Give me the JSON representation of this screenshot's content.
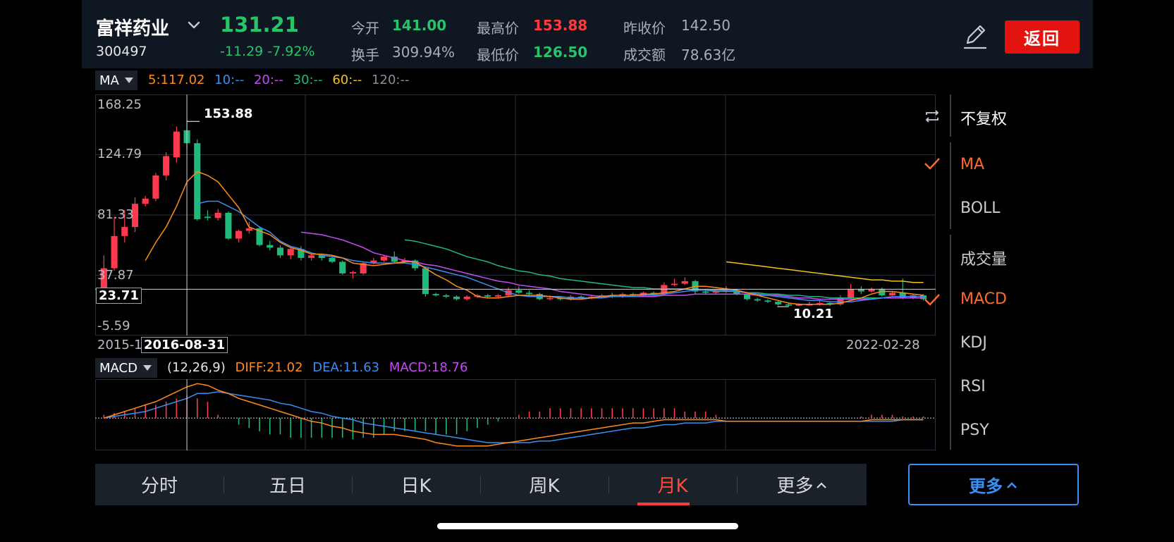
{
  "stock": {
    "name": "富祥药业",
    "code": "300497",
    "price": "131.21",
    "change": "-11.29 -7.92%"
  },
  "quote": {
    "open_label": "今开",
    "open": "141.00",
    "high_label": "最高价",
    "high": "153.88",
    "prev_close_label": "昨收价",
    "prev_close": "142.50",
    "turnover_rate_label": "换手",
    "turnover_rate": "309.94%",
    "low_label": "最低价",
    "low": "126.50",
    "amount_label": "成交额",
    "amount": "78.63亿"
  },
  "header": {
    "back_label": "返回"
  },
  "colors": {
    "up": "#ff3a4f",
    "down": "#1fb97a",
    "ma5": "#ff8a1c",
    "ma10": "#3a8ff2",
    "ma20": "#c44cf2",
    "ma30": "#1fb97a",
    "ma60": "#f2c21f",
    "ma120": "#8a8d93",
    "accent": "#ff6a2c"
  },
  "main_indicator": {
    "name": "MA",
    "items": [
      "5:117.02",
      "10:--",
      "20:--",
      "30:--",
      "60:--",
      "120:--"
    ]
  },
  "main_chart": {
    "y_labels": [
      "168.25",
      "124.79",
      "81.33",
      "37.87",
      "-5.59"
    ],
    "start_date": "2015-1",
    "cursor_date": "2016-08-31",
    "end_date": "2022-02-28",
    "crosshair_price": "23.71",
    "max_label": "153.88",
    "min_label": "10.21"
  },
  "sub_indicator": {
    "name": "MACD",
    "params": "(12,26,9)",
    "diff": "DIFF:21.02",
    "dea": "DEA:11.63",
    "macd": "MACD:18.76"
  },
  "side_panel": {
    "adjust": "不复权",
    "overlays": [
      "MA",
      "BOLL"
    ],
    "overlay_selected": "MA",
    "indicators": [
      "成交量",
      "MACD",
      "KDJ",
      "RSI",
      "PSY"
    ],
    "indicator_selected": "MACD"
  },
  "tabs": [
    "分时",
    "五日",
    "日K",
    "周K",
    "月K",
    "更多"
  ],
  "active_tab": "月K",
  "more_button": "更多",
  "chart_data": {
    "type": "candlestick",
    "y_range": [
      -5.59,
      168.25
    ],
    "candles": [
      {
        "o": 20,
        "c": 40,
        "h": 50,
        "l": 18
      },
      {
        "o": 40,
        "c": 65,
        "h": 80,
        "l": 38
      },
      {
        "o": 65,
        "c": 72,
        "h": 85,
        "l": 60
      },
      {
        "o": 72,
        "c": 90,
        "h": 95,
        "l": 68
      },
      {
        "o": 90,
        "c": 94,
        "h": 96,
        "l": 88
      },
      {
        "o": 94,
        "c": 112,
        "h": 114,
        "l": 92
      },
      {
        "o": 112,
        "c": 127,
        "h": 130,
        "l": 108
      },
      {
        "o": 126,
        "c": 146,
        "h": 150,
        "l": 122
      },
      {
        "o": 147,
        "c": 137,
        "h": 155,
        "l": 132
      },
      {
        "o": 137,
        "c": 78,
        "h": 140,
        "l": 77
      },
      {
        "o": 80,
        "c": 79,
        "h": 85,
        "l": 77
      },
      {
        "o": 79,
        "c": 83,
        "h": 86,
        "l": 77
      },
      {
        "o": 83,
        "c": 63,
        "h": 84,
        "l": 62
      },
      {
        "o": 63,
        "c": 69,
        "h": 70,
        "l": 60
      },
      {
        "o": 69,
        "c": 71,
        "h": 76,
        "l": 67
      },
      {
        "o": 71,
        "c": 58,
        "h": 72,
        "l": 57
      },
      {
        "o": 58,
        "c": 56,
        "h": 61,
        "l": 54
      },
      {
        "o": 56,
        "c": 50,
        "h": 58,
        "l": 48
      },
      {
        "o": 50,
        "c": 55,
        "h": 56,
        "l": 47
      },
      {
        "o": 55,
        "c": 48,
        "h": 57,
        "l": 46
      },
      {
        "o": 48,
        "c": 50,
        "h": 51,
        "l": 46
      },
      {
        "o": 50,
        "c": 48,
        "h": 51,
        "l": 46
      },
      {
        "o": 48,
        "c": 45,
        "h": 50,
        "l": 44
      },
      {
        "o": 45,
        "c": 36,
        "h": 46,
        "l": 35
      },
      {
        "o": 36,
        "c": 37,
        "h": 38,
        "l": 32
      },
      {
        "o": 36,
        "c": 44,
        "h": 45,
        "l": 35
      },
      {
        "o": 44,
        "c": 46,
        "h": 48,
        "l": 43
      },
      {
        "o": 46,
        "c": 49,
        "h": 50,
        "l": 45
      },
      {
        "o": 49,
        "c": 45,
        "h": 53,
        "l": 44
      },
      {
        "o": 45,
        "c": 46,
        "h": 48,
        "l": 44
      },
      {
        "o": 46,
        "c": 40,
        "h": 47,
        "l": 38
      },
      {
        "o": 40,
        "c": 20,
        "h": 41,
        "l": 18
      },
      {
        "o": 20,
        "c": 19,
        "h": 21,
        "l": 18
      },
      {
        "o": 19,
        "c": 18,
        "h": 20,
        "l": 17
      },
      {
        "o": 18,
        "c": 16,
        "h": 19,
        "l": 15
      },
      {
        "o": 16,
        "c": 18,
        "h": 19,
        "l": 15
      },
      {
        "o": 18,
        "c": 19,
        "h": 20,
        "l": 17
      },
      {
        "o": 19,
        "c": 18,
        "h": 20,
        "l": 17
      },
      {
        "o": 18,
        "c": 19,
        "h": 20,
        "l": 17
      },
      {
        "o": 19,
        "c": 23,
        "h": 25,
        "l": 18
      },
      {
        "o": 23,
        "c": 21,
        "h": 26,
        "l": 20
      },
      {
        "o": 21,
        "c": 20,
        "h": 23,
        "l": 19
      },
      {
        "o": 20,
        "c": 16,
        "h": 21,
        "l": 15
      },
      {
        "o": 16,
        "c": 17,
        "h": 19,
        "l": 15
      },
      {
        "o": 17,
        "c": 16,
        "h": 18,
        "l": 15
      },
      {
        "o": 16,
        "c": 18,
        "h": 19,
        "l": 15
      },
      {
        "o": 18,
        "c": 17,
        "h": 19,
        "l": 16
      },
      {
        "o": 17,
        "c": 18,
        "h": 19,
        "l": 16
      },
      {
        "o": 18,
        "c": 19,
        "h": 20,
        "l": 17
      },
      {
        "o": 19,
        "c": 18,
        "h": 21,
        "l": 17
      },
      {
        "o": 18,
        "c": 20,
        "h": 21,
        "l": 17
      },
      {
        "o": 20,
        "c": 19,
        "h": 21,
        "l": 18
      },
      {
        "o": 19,
        "c": 21,
        "h": 22,
        "l": 18
      },
      {
        "o": 21,
        "c": 20,
        "h": 22,
        "l": 19
      },
      {
        "o": 20,
        "c": 27,
        "h": 29,
        "l": 19
      },
      {
        "o": 27,
        "c": 28,
        "h": 32,
        "l": 26
      },
      {
        "o": 28,
        "c": 30,
        "h": 33,
        "l": 27
      },
      {
        "o": 30,
        "c": 22,
        "h": 31,
        "l": 20
      },
      {
        "o": 22,
        "c": 21,
        "h": 24,
        "l": 20
      },
      {
        "o": 21,
        "c": 22,
        "h": 23,
        "l": 20
      },
      {
        "o": 22,
        "c": 23,
        "h": 26,
        "l": 21
      },
      {
        "o": 23,
        "c": 20,
        "h": 24,
        "l": 19
      },
      {
        "o": 20,
        "c": 16,
        "h": 21,
        "l": 15
      },
      {
        "o": 16,
        "c": 15,
        "h": 17,
        "l": 14
      },
      {
        "o": 15,
        "c": 14,
        "h": 16,
        "l": 13
      },
      {
        "o": 14,
        "c": 12,
        "h": 15,
        "l": 11
      },
      {
        "o": 12,
        "c": 11,
        "h": 13,
        "l": 10.21
      },
      {
        "o": 11,
        "c": 12,
        "h": 13,
        "l": 10.5
      },
      {
        "o": 12,
        "c": 12,
        "h": 14,
        "l": 11
      },
      {
        "o": 12,
        "c": 13,
        "h": 15,
        "l": 11
      },
      {
        "o": 13,
        "c": 12,
        "h": 14,
        "l": 11
      },
      {
        "o": 12,
        "c": 17,
        "h": 19,
        "l": 11
      },
      {
        "o": 17,
        "c": 24,
        "h": 28,
        "l": 16
      },
      {
        "o": 24,
        "c": 22,
        "h": 26,
        "l": 20
      },
      {
        "o": 22,
        "c": 24,
        "h": 25,
        "l": 21
      },
      {
        "o": 24,
        "c": 19,
        "h": 25,
        "l": 18
      },
      {
        "o": 19,
        "c": 21,
        "h": 22,
        "l": 18
      },
      {
        "o": 21,
        "c": 17,
        "h": 32,
        "l": 16
      },
      {
        "o": 17,
        "c": 19,
        "h": 20,
        "l": 16
      },
      {
        "o": 19,
        "c": 16,
        "h": 20,
        "l": 15
      }
    ],
    "ma5": [
      null,
      null,
      null,
      null,
      46,
      60,
      72,
      88,
      107,
      115,
      112,
      107,
      97,
      87,
      72,
      69,
      66,
      60,
      56,
      54,
      51,
      51,
      50,
      48,
      44,
      43,
      42,
      43,
      44,
      45,
      45,
      40,
      35,
      31,
      26,
      23,
      18,
      17,
      17,
      18,
      19,
      19,
      19,
      18,
      17,
      16,
      16,
      17,
      18,
      19,
      19,
      19,
      20,
      20,
      21,
      22,
      24,
      26,
      26,
      25,
      24,
      23,
      21,
      19,
      17,
      15,
      13,
      12,
      12,
      12,
      12,
      13,
      15,
      17,
      20,
      22,
      22,
      21,
      20,
      19
    ],
    "ma10": [
      null,
      null,
      null,
      null,
      null,
      null,
      null,
      null,
      null,
      90,
      92,
      92,
      88,
      84,
      78,
      72,
      68,
      61,
      57,
      55,
      52,
      50,
      49,
      48,
      46,
      45,
      44,
      44,
      44,
      44,
      43,
      41,
      39,
      37,
      35,
      33,
      30,
      27,
      24,
      21,
      19,
      18,
      18,
      18,
      18,
      17,
      17,
      17,
      17,
      18,
      18,
      18,
      19,
      19,
      20,
      21,
      22,
      23,
      23,
      23,
      23,
      22,
      21,
      20,
      19,
      18,
      17,
      16,
      15,
      15,
      14,
      14,
      14,
      15,
      16,
      17,
      18,
      18,
      18,
      18
    ],
    "ma20": [
      null,
      null,
      null,
      null,
      null,
      null,
      null,
      null,
      null,
      null,
      null,
      null,
      null,
      null,
      null,
      null,
      null,
      null,
      null,
      68,
      67,
      66,
      64,
      62,
      59,
      56,
      52,
      50,
      48,
      46,
      45,
      43,
      42,
      40,
      38,
      36,
      34,
      32,
      30,
      29,
      27,
      26,
      25,
      24,
      22,
      21,
      20,
      19,
      18,
      18,
      18,
      18,
      18,
      18,
      19,
      19,
      19,
      20,
      20,
      20,
      20,
      20,
      20,
      19,
      19,
      19,
      18,
      17,
      17,
      16,
      16,
      16,
      16,
      16,
      16,
      17,
      17,
      17,
      17,
      17
    ],
    "ma30": [
      null,
      null,
      null,
      null,
      null,
      null,
      null,
      null,
      null,
      null,
      null,
      null,
      null,
      null,
      null,
      null,
      null,
      null,
      null,
      null,
      null,
      null,
      null,
      null,
      null,
      null,
      null,
      null,
      null,
      62,
      61,
      59,
      57,
      55,
      52,
      49,
      47,
      45,
      42,
      40,
      38,
      37,
      35,
      34,
      32,
      31,
      30,
      29,
      28,
      27,
      26,
      25,
      25,
      24,
      24,
      24,
      24,
      23,
      23,
      22,
      22,
      22,
      21,
      21,
      20,
      20,
      19,
      19,
      18,
      18,
      17,
      17,
      17,
      17,
      17,
      17,
      17,
      17,
      17,
      17
    ],
    "ma60": [
      null,
      null,
      null,
      null,
      null,
      null,
      null,
      null,
      null,
      null,
      null,
      null,
      null,
      null,
      null,
      null,
      null,
      null,
      null,
      null,
      null,
      null,
      null,
      null,
      null,
      null,
      null,
      null,
      null,
      null,
      null,
      null,
      null,
      null,
      null,
      null,
      null,
      null,
      null,
      null,
      null,
      null,
      null,
      null,
      null,
      null,
      null,
      null,
      null,
      null,
      null,
      null,
      null,
      null,
      null,
      null,
      null,
      null,
      null,
      null,
      45,
      44,
      43,
      42,
      41,
      40,
      39,
      38,
      37,
      36,
      35,
      34,
      33,
      32,
      31,
      31,
      30,
      30,
      29,
      29
    ],
    "diff": [
      0,
      2,
      4,
      6,
      8,
      10,
      13,
      16,
      19,
      21,
      20,
      17,
      15,
      12,
      10,
      8,
      6,
      4,
      2,
      0,
      -2,
      -3,
      -5,
      -6,
      -8,
      -9,
      -10,
      -10,
      -10,
      -11,
      -12,
      -13,
      -15,
      -16,
      -17,
      -17,
      -17,
      -17,
      -16,
      -15,
      -14,
      -13,
      -12,
      -11,
      -10,
      -9,
      -8,
      -7,
      -6,
      -5,
      -4,
      -3,
      -3,
      -2,
      -1,
      -1,
      -1,
      -1,
      -1,
      -1,
      -2,
      -2,
      -2,
      -2,
      -2,
      -2,
      -2,
      -2,
      -2,
      -2,
      -2,
      -2,
      -2,
      -2,
      -1,
      -1,
      -1,
      -1,
      -1,
      -1
    ],
    "dea": [
      0,
      1,
      2,
      3,
      4,
      6,
      8,
      10,
      12,
      15,
      15,
      16,
      15,
      14,
      13,
      12,
      11,
      9,
      8,
      6,
      4,
      3,
      1,
      0,
      -1,
      -3,
      -4,
      -5,
      -6,
      -7,
      -8,
      -9,
      -10,
      -11,
      -12,
      -13,
      -14,
      -15,
      -15,
      -15,
      -15,
      -15,
      -14,
      -14,
      -13,
      -12,
      -11,
      -10,
      -9,
      -8,
      -7,
      -6,
      -6,
      -5,
      -4,
      -4,
      -3,
      -3,
      -3,
      -2,
      -2,
      -2,
      -2,
      -2,
      -2,
      -2,
      -2,
      -2,
      -2,
      -2,
      -2,
      -2,
      -2,
      -2,
      -2,
      -2,
      -2,
      -1,
      -1,
      -1
    ],
    "macd": [
      2,
      3,
      4,
      6,
      8,
      8,
      10,
      12,
      14,
      12,
      10,
      2,
      0,
      -4,
      -6,
      -8,
      -10,
      -10,
      -12,
      -12,
      -12,
      -12,
      -12,
      -12,
      -13,
      -12,
      -12,
      -10,
      -8,
      -8,
      -8,
      -8,
      -10,
      -10,
      -10,
      -8,
      -6,
      -4,
      -2,
      0,
      2,
      4,
      4,
      6,
      6,
      6,
      6,
      6,
      6,
      6,
      6,
      6,
      6,
      6,
      6,
      6,
      4,
      4,
      4,
      2,
      0,
      0,
      0,
      0,
      0,
      0,
      0,
      0,
      0,
      0,
      0,
      0,
      0,
      1,
      2,
      2,
      2,
      1,
      1,
      1
    ]
  }
}
